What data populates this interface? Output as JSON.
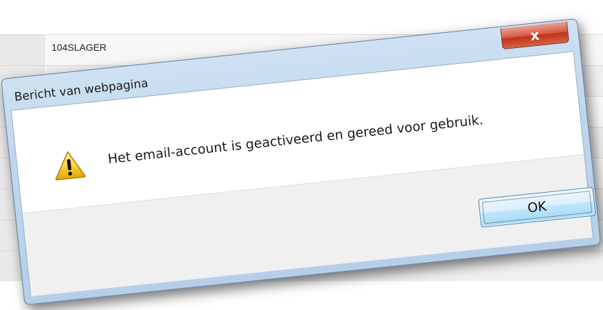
{
  "background": {
    "first_row_text": "104SLAGER"
  },
  "dialog": {
    "title": "Bericht van webpagina",
    "close_label": "x",
    "message": "Het email-account is geactiveerd en gereed voor gebruik.",
    "icon": "warning-icon",
    "ok_label": "OK"
  },
  "colors": {
    "close_button": "#c0301a",
    "ok_button": "#bee6fd",
    "titlebar": "#bed6ee"
  }
}
